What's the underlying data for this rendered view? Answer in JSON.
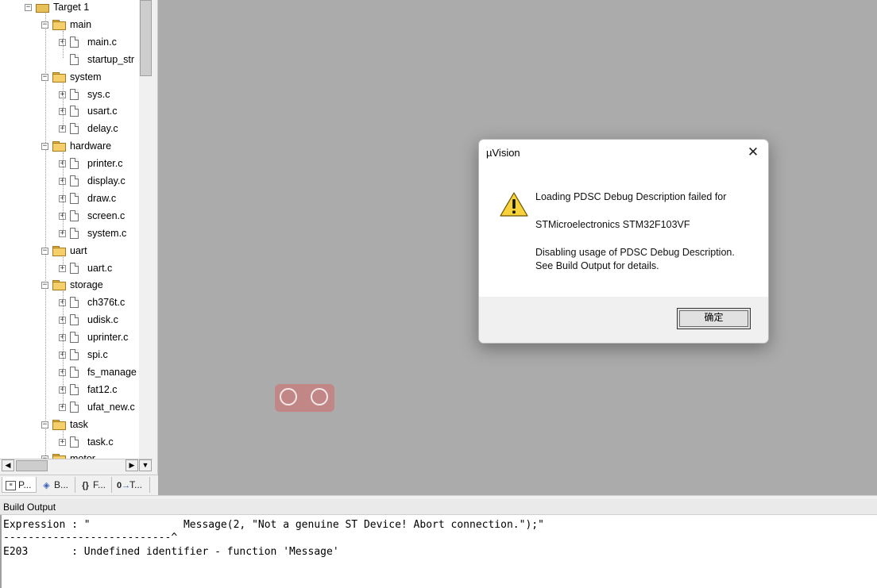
{
  "tree": {
    "root": "Target 1",
    "groups": [
      {
        "name": "main",
        "files": [
          "main.c",
          "startup_str"
        ]
      },
      {
        "name": "system",
        "files": [
          "sys.c",
          "usart.c",
          "delay.c"
        ]
      },
      {
        "name": "hardware",
        "files": [
          "printer.c",
          "display.c",
          "draw.c",
          "screen.c",
          "system.c"
        ]
      },
      {
        "name": "uart",
        "files": [
          "uart.c"
        ]
      },
      {
        "name": "storage",
        "files": [
          "ch376t.c",
          "udisk.c",
          "uprinter.c",
          "spi.c",
          "fs_manage",
          "fat12.c",
          "ufat_new.c"
        ]
      },
      {
        "name": "task",
        "files": [
          "task.c"
        ]
      },
      {
        "name": "motor",
        "files": []
      }
    ]
  },
  "panel_tabs": [
    {
      "label": "P...",
      "icon": "project-icon"
    },
    {
      "label": "B...",
      "icon": "books-icon"
    },
    {
      "label": "F...",
      "icon": "functions-icon"
    },
    {
      "label": "T...",
      "icon": "templates-icon"
    }
  ],
  "build_output": {
    "title": "Build Output",
    "lines": [
      "Expression : \"               Message(2, \"Not a genuine ST Device! Abort connection.\");\"",
      "---------------------------^",
      "E203       : Undefined identifier - function 'Message'"
    ]
  },
  "dialog": {
    "title": "µVision",
    "close_glyph": "✕",
    "icon": "warning-icon",
    "message_lines": [
      "Loading PDSC Debug Description failed for",
      "STMicroelectronics STM32F103VF",
      "Disabling usage of PDSC Debug Description.",
      "See Build Output for details."
    ],
    "ok_label": "确定"
  },
  "colors": {
    "workspace": "#ababab",
    "panel": "#f0f0f0",
    "folder": "#f6cf6a"
  }
}
